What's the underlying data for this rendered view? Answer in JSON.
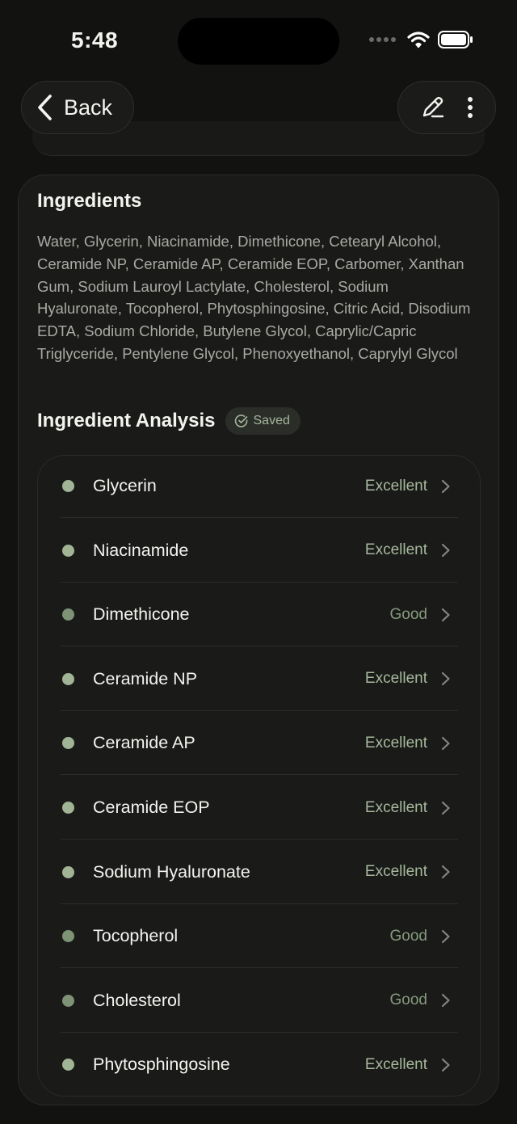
{
  "status_bar": {
    "time": "5:48"
  },
  "header": {
    "back_label": "Back"
  },
  "ingredients": {
    "title": "Ingredients",
    "text": "Water, Glycerin, Niacinamide, Dimethicone, Cetearyl Alcohol, Ceramide NP, Ceramide AP, Ceramide EOP, Carbomer, Xanthan Gum, Sodium Lauroyl Lactylate, Cholesterol, Sodium Hyaluronate, Tocopherol, Phytosphingosine, Citric Acid, Disodium EDTA, Sodium Chloride, Butylene Glycol, Caprylic/Capric Triglyceride, Pentylene Glycol, Phenoxyethanol, Caprylyl Glycol"
  },
  "analysis": {
    "title": "Ingredient Analysis",
    "saved_label": "Saved",
    "items": [
      {
        "name": "Glycerin",
        "rating": "Excellent"
      },
      {
        "name": "Niacinamide",
        "rating": "Excellent"
      },
      {
        "name": "Dimethicone",
        "rating": "Good"
      },
      {
        "name": "Ceramide NP",
        "rating": "Excellent"
      },
      {
        "name": "Ceramide AP",
        "rating": "Excellent"
      },
      {
        "name": "Ceramide EOP",
        "rating": "Excellent"
      },
      {
        "name": "Sodium Hyaluronate",
        "rating": "Excellent"
      },
      {
        "name": "Tocopherol",
        "rating": "Good"
      },
      {
        "name": "Cholesterol",
        "rating": "Good"
      },
      {
        "name": "Phytosphingosine",
        "rating": "Excellent"
      }
    ]
  },
  "colors": {
    "excellent": "#a1b596",
    "good": "#7e9276",
    "background": "#121211",
    "card": "#1a1a19"
  },
  "icons": [
    "chevron-left-icon",
    "edit-pencil-icon",
    "more-vertical-icon",
    "check-circle-icon",
    "chevron-right-icon",
    "wifi-icon",
    "battery-icon",
    "cellular-signal-icon"
  ]
}
